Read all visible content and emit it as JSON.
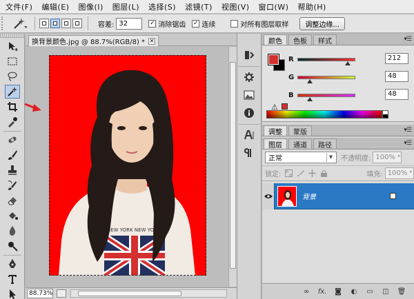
{
  "menubar": {
    "items": [
      {
        "label": "文件(F)"
      },
      {
        "label": "编辑(E)"
      },
      {
        "label": "图像(I)"
      },
      {
        "label": "图层(L)"
      },
      {
        "label": "选择(S)"
      },
      {
        "label": "滤镜(T)"
      },
      {
        "label": "视图(V)"
      },
      {
        "label": "窗口(W)"
      },
      {
        "label": "帮助(H)"
      }
    ]
  },
  "options": {
    "tolerance_label": "容差:",
    "tolerance_value": "32",
    "antialias_label": "消除锯齿",
    "antialias_checked": true,
    "contiguous_label": "连续",
    "contiguous_checked": true,
    "sample_all_label": "对所有图层取样",
    "sample_all_checked": false,
    "refine_edge_label": "调整边缘..."
  },
  "document": {
    "tab_title": "换背景颜色.jpg @ 88.7%(RGB/8) *",
    "zoom": "88.73%",
    "background_color": "#ff0000"
  },
  "color_panel": {
    "tabs": [
      "颜色",
      "色板",
      "样式"
    ],
    "r_label": "R",
    "r_value": "212",
    "g_label": "G",
    "g_value": "48",
    "b_label": "B",
    "b_value": "48",
    "foreground": "#d43030",
    "background": "#000000"
  },
  "adjust_panel": {
    "tabs": [
      "调整",
      "蒙版"
    ]
  },
  "layers_panel": {
    "tabs": [
      "图层",
      "通道",
      "路径"
    ],
    "blend_mode": "正常",
    "opacity_label": "不透明度:",
    "opacity_value": "100%",
    "lock_label": "锁定:",
    "fill_label": "填充:",
    "fill_value": "100%",
    "layers": [
      {
        "name": "背景",
        "selected": true,
        "locked": true
      }
    ]
  },
  "colors": {
    "accent": "#2a79c5",
    "annotation": "#e02020"
  }
}
